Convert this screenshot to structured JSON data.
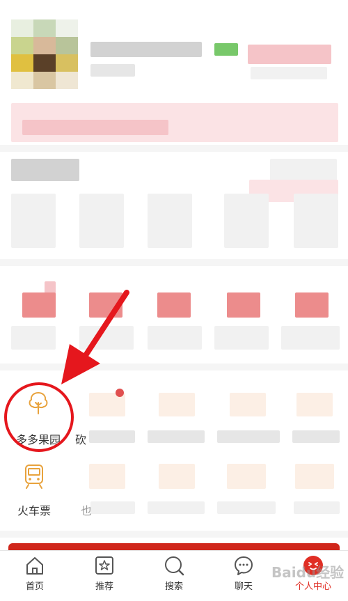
{
  "grid": {
    "orchard_label": "多多果园",
    "bargain_label_partial": "砍",
    "train_label": "火车票",
    "second_row_partial": "也"
  },
  "tabbar": {
    "home": "首页",
    "recommend": "推荐",
    "search": "搜索",
    "chat": "聊天",
    "profile": "个人中心"
  },
  "watermark": "Baidu经验",
  "colors": {
    "accent": "#e02e24",
    "highlight": "#e5171d",
    "icon_orange": "#e8a23c"
  }
}
